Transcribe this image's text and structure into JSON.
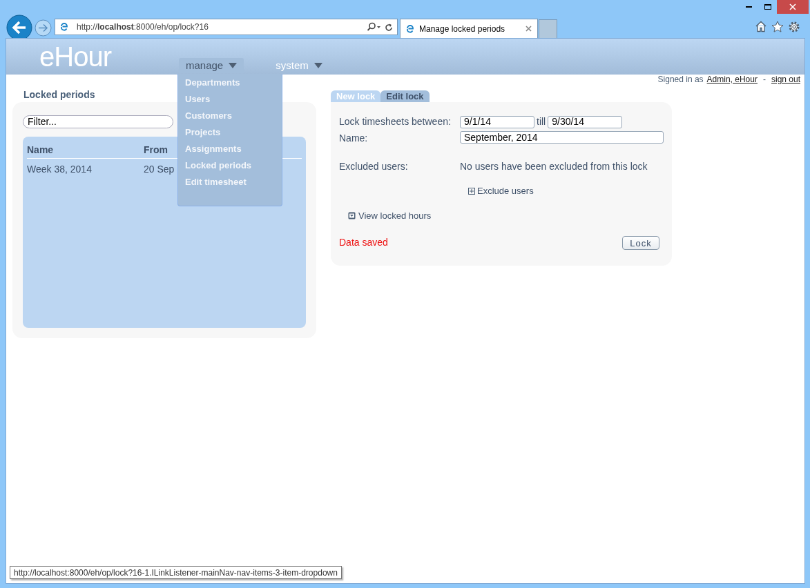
{
  "browser": {
    "address": "http://**localhost**:8000/eh/op/lock?16",
    "tab_title": "Manage locked periods",
    "status_tooltip": "http://localhost:8000/eh/op/lock?16-1.ILinkListener-mainNav-nav-items-3-item-dropdown"
  },
  "header": {
    "logo": "eHour",
    "nav": [
      {
        "label": "manage",
        "expanded": true,
        "items": [
          "Departments",
          "Users",
          "Customers",
          "Projects",
          "Assignments",
          "Locked periods",
          "Edit timesheet"
        ]
      },
      {
        "label": "system",
        "expanded": false
      }
    ],
    "signed_in": {
      "prefix": "Signed in as",
      "user": "Admin, eHour",
      "separator": "-",
      "sign_out": "sign out"
    }
  },
  "locked_periods": {
    "title": "Locked periods",
    "filter": {
      "placeholder": "Filter..."
    },
    "table": {
      "columns": [
        "Name",
        "From"
      ],
      "rows": [
        [
          "Week 38, 2014",
          "20 Sep"
        ]
      ]
    }
  },
  "lock_form": {
    "tabs": [
      {
        "label": "New lock",
        "selected": false
      },
      {
        "label": "Edit lock",
        "selected": true
      }
    ],
    "between_label": "Lock timesheets between:",
    "start_date": "9/1/14",
    "till_label": "till",
    "end_date": "9/30/14",
    "name_label": "Name:",
    "name": "September, 2014",
    "excluded_label": "Excluded users:",
    "excluded_text": "No users have been excluded from this lock",
    "exclude_link": "Exclude users",
    "view_link": "View locked hours",
    "message": "Data saved",
    "lock_button": "Lock"
  }
}
